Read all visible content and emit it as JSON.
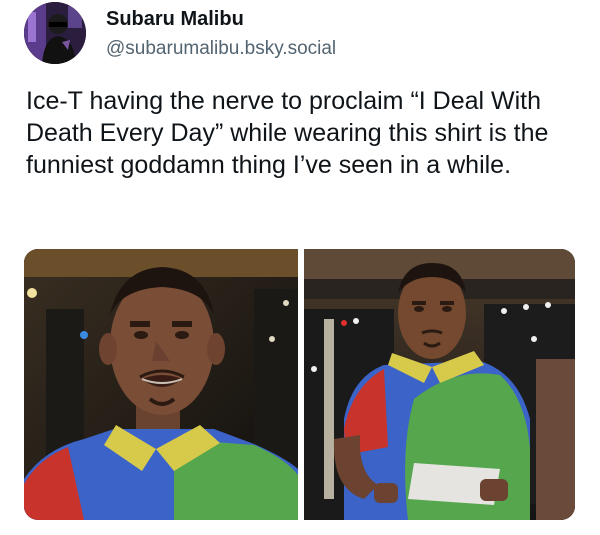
{
  "author": {
    "name": "Subaru Malibu",
    "handle": "@subarumalibu.bsky.social"
  },
  "post": {
    "text": "Ice-T having the nerve to proclaim “I Deal With Death Every Day” while wearing this shirt is the funniest goddamn thing I’ve seen in a while."
  },
  "media": {
    "colors": {
      "shirt_blue": "#3b63c8",
      "shirt_green": "#56a64e",
      "shirt_red": "#c8342b",
      "collar_yellow": "#d7c94a"
    }
  }
}
